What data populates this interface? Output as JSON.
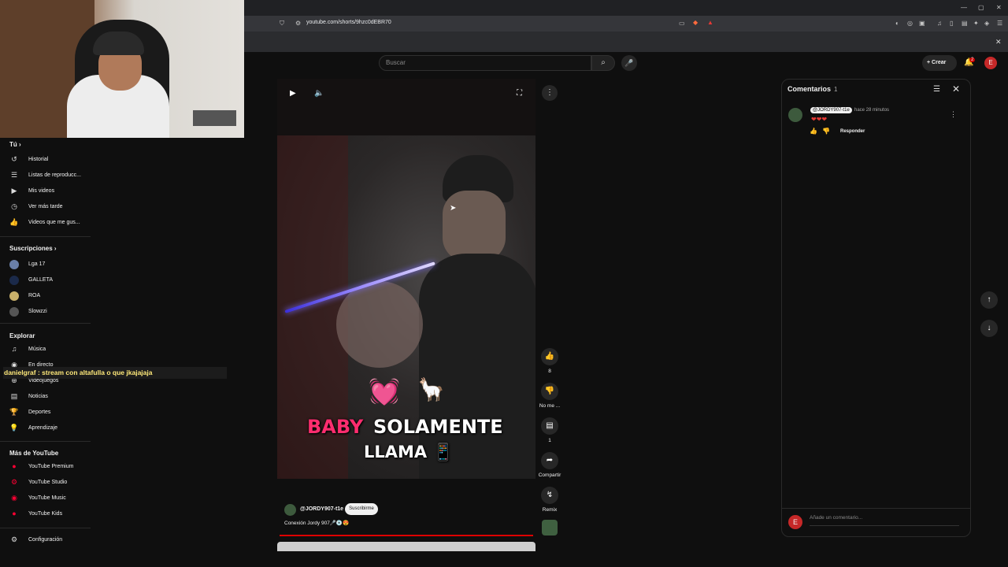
{
  "browser": {
    "url": "youtube.com/shorts/9hzc0dEBR70",
    "window_controls": [
      "—",
      "▢",
      "✕"
    ]
  },
  "header": {
    "search_placeholder": "Buscar",
    "create_label": "Crear",
    "notification_count": "2",
    "account_initial": "E"
  },
  "sidebar": {
    "you_label": "Tú",
    "you_items": [
      {
        "label": "Historial",
        "icon": "history-icon"
      },
      {
        "label": "Listas de reproducc...",
        "icon": "playlist-icon"
      },
      {
        "label": "Mis videos",
        "icon": "video-icon"
      },
      {
        "label": "Ver más tarde",
        "icon": "clock-icon"
      },
      {
        "label": "Videos que me gus...",
        "icon": "thumbs-up-icon"
      }
    ],
    "subs_label": "Suscripciones",
    "subs": [
      {
        "label": "Lga 17",
        "color": "#6a7fa8"
      },
      {
        "label": "GALLETA",
        "color": "#1b2a4a"
      },
      {
        "label": "ROA",
        "color": "#c8b06a"
      },
      {
        "label": "Slowzzi",
        "color": "#555555"
      }
    ],
    "explore_label": "Explorar",
    "explore_items": [
      {
        "label": "Música",
        "icon": "music-icon"
      },
      {
        "label": "En directo",
        "icon": "live-icon"
      },
      {
        "label": "Videojuegos",
        "icon": "gamepad-icon"
      },
      {
        "label": "Noticias",
        "icon": "news-icon"
      },
      {
        "label": "Deportes",
        "icon": "trophy-icon"
      },
      {
        "label": "Aprendizaje",
        "icon": "bulb-icon"
      }
    ],
    "more_label": "Más de YouTube",
    "more_items": [
      {
        "label": "YouTube Premium"
      },
      {
        "label": "YouTube Studio"
      },
      {
        "label": "YouTube Music"
      },
      {
        "label": "YouTube Kids"
      }
    ],
    "settings_label": "Configuración"
  },
  "chat_overlay": "danielgraf : stream con altafulla o que jkajajaja",
  "video": {
    "caption_word1": "BABY",
    "caption_word2": "SOLAMENTE",
    "caption_line2": "LLAMA 📱",
    "heart_emoji": "💓",
    "llama_emoji": "🦙",
    "channel": "@JORDY907-t1e",
    "subscribe_label": "Suscribirme",
    "title": "Conexión Jordy 907🎤💿😍"
  },
  "actions": {
    "like_count": "8",
    "dislike_label": "No me ...",
    "comments_count": "1",
    "share_label": "Compartir",
    "remix_label": "Remix"
  },
  "comments": {
    "title": "Comentarios",
    "count": "1",
    "items": [
      {
        "author": "@JORDY907-t1e",
        "time": "hace 28 minutos",
        "text": "❤❤❤",
        "reply_label": "Responder"
      }
    ],
    "input_placeholder": "Añade un comentario...",
    "my_initial": "E"
  }
}
